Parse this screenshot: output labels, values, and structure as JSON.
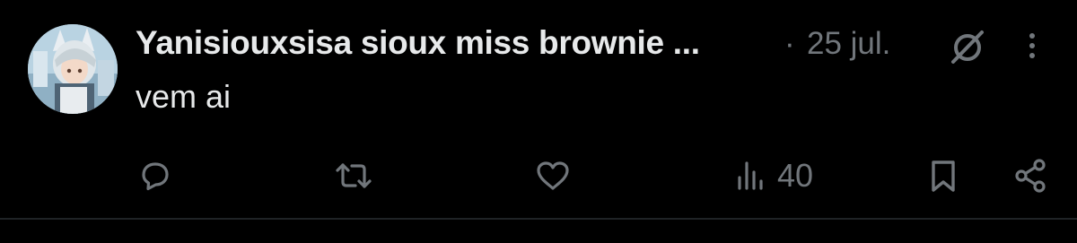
{
  "post": {
    "author_name": "Yanisiouxsisa sioux miss brownie ...",
    "separator": "·",
    "date": "25 jul.",
    "text": "vem ai",
    "views_count": "40"
  },
  "colors": {
    "background": "#000000",
    "primary_text": "#e7e9ea",
    "secondary_text": "#71767b",
    "divider": "#1f2326"
  },
  "icons": {
    "reply": "comment-bubble-icon",
    "repost": "repost-icon",
    "like": "heart-icon",
    "views": "bar-chart-icon",
    "bookmark": "bookmark-icon",
    "share": "share-icon",
    "grok": "grok-icon",
    "more": "more-dots-icon"
  }
}
